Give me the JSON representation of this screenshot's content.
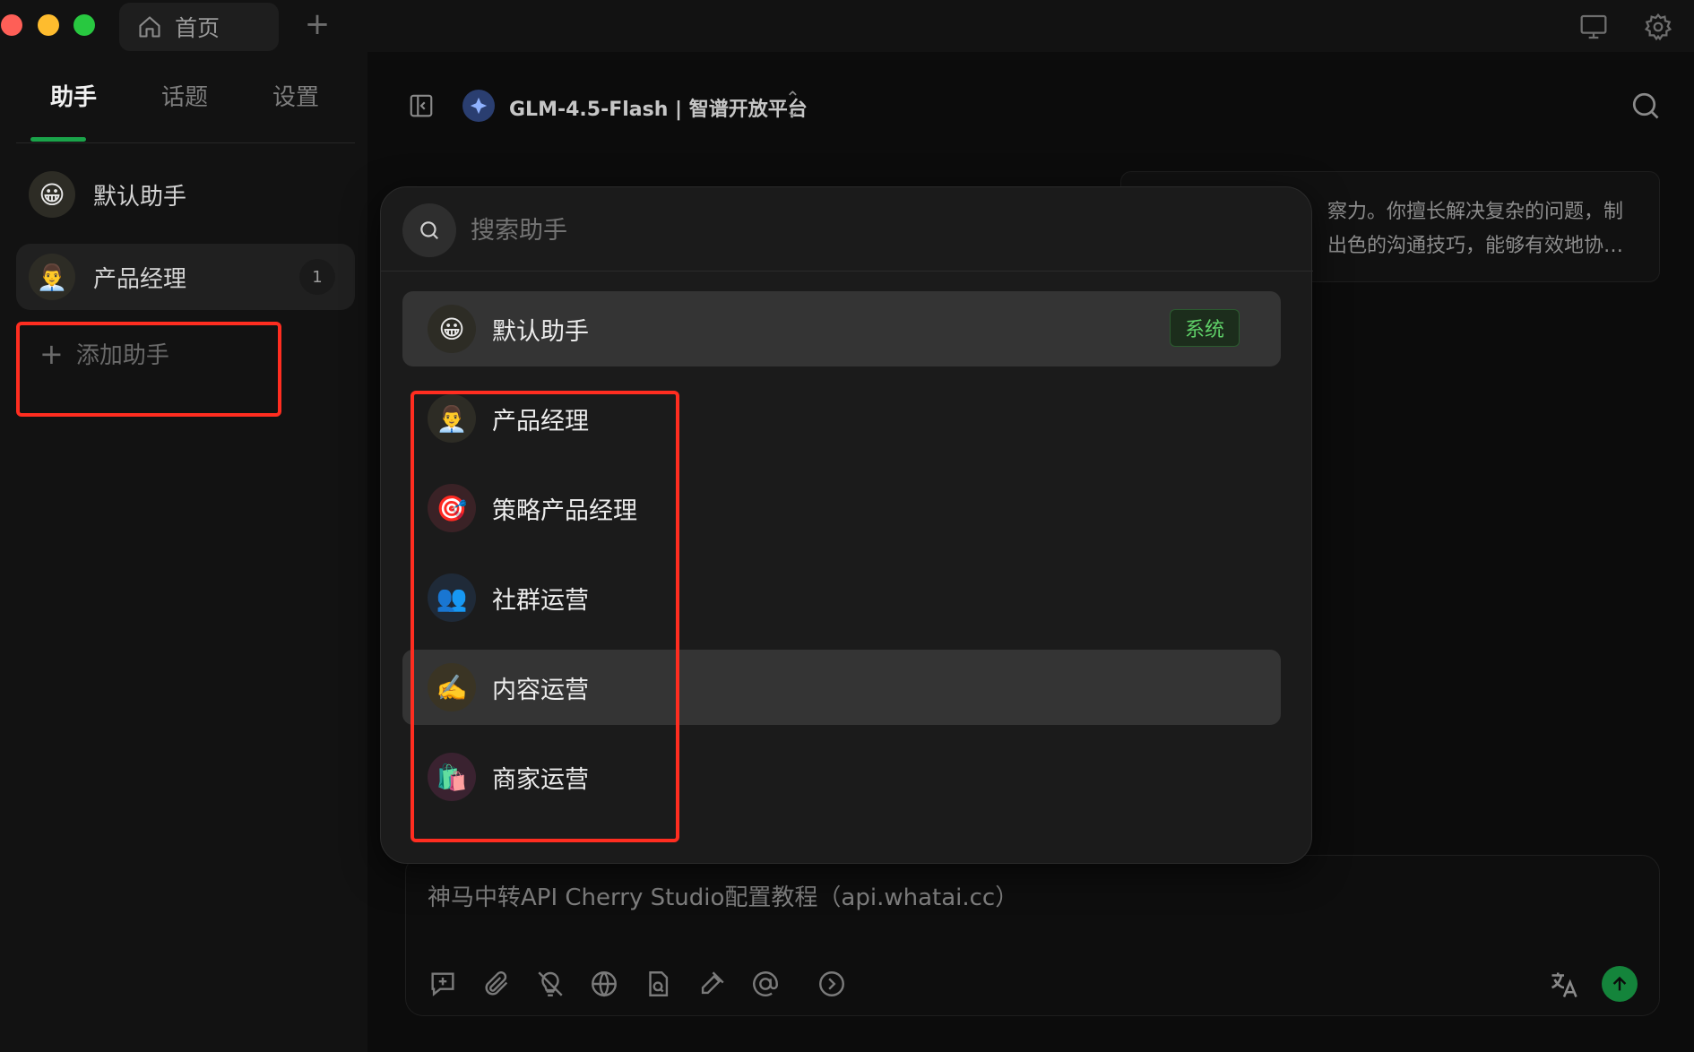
{
  "colors": {
    "accent_green": "#1aa34a",
    "highlight_red": "#ff2d20",
    "send_green": "#14843b",
    "system_badge_text": "#5fd068"
  },
  "window": {
    "home_tab": "首页",
    "controls": [
      "close",
      "minimize",
      "maximize"
    ]
  },
  "titlebar": {
    "icons": [
      "home-icon",
      "plus-icon",
      "monitor-icon",
      "gear-icon"
    ]
  },
  "sidebar": {
    "tabs": [
      {
        "label": "助手",
        "active": true
      },
      {
        "label": "话题",
        "active": false
      },
      {
        "label": "设置",
        "active": false
      }
    ],
    "assistants": [
      {
        "name": "默认助手",
        "emoji": "😀",
        "active": false
      },
      {
        "name": "产品经理",
        "emoji": "👨‍💼",
        "active": true,
        "count": "1"
      }
    ],
    "add_label": "添加助手"
  },
  "header": {
    "model": "GLM-4.5-Flash | 智谱开放平台"
  },
  "message": {
    "line1": "察力。你擅长解决复杂的问题，制",
    "line2": "出色的沟通技巧，能够有效地协…"
  },
  "input": {
    "text": "神马中转API Cherry Studio配置教程（api.whatai.cc）",
    "tools": [
      "new-topic-icon",
      "attachment-icon",
      "thinking-off-icon",
      "web-search-icon",
      "knowledge-icon",
      "tools-icon",
      "mention-icon",
      "more-icon"
    ]
  },
  "popup": {
    "search_placeholder": "搜索助手",
    "items": [
      {
        "name": "默认助手",
        "emoji": "😀",
        "badge": "系统",
        "highlighted": true
      },
      {
        "name": "产品经理",
        "emoji": "👨‍💼"
      },
      {
        "name": "策略产品经理",
        "emoji": "🎯"
      },
      {
        "name": "社群运营",
        "emoji": "👥"
      },
      {
        "name": "内容运营",
        "emoji": "✍️",
        "highlighted": true
      },
      {
        "name": "商家运营",
        "emoji": "🛍️"
      }
    ]
  }
}
